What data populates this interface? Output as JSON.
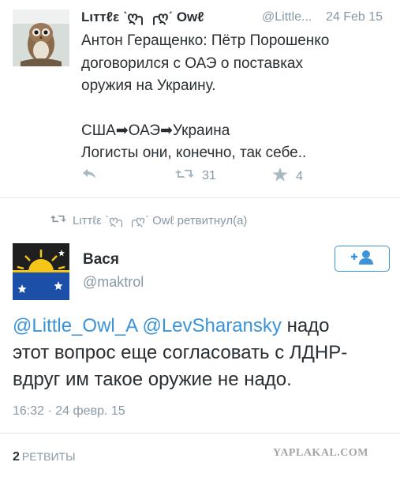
{
  "tweet": {
    "author_name": "Lιттℓε ˋღ╮ ╭ღˊ Owℓ",
    "author_handle": "@Little...",
    "date": "24 Feb 15",
    "text_lines": [
      "Антон Геращенко: Пётр Порошенко",
      "договорился с ОАЭ о поставках",
      "оружия на Украину.",
      "",
      "США➡ОАЭ➡Украина",
      "Логисты они, конечно, так себе.."
    ],
    "actions": {
      "reply_icon": "reply-icon",
      "retweet_icon": "retweet-icon",
      "retweet_count": "31",
      "favorite_icon": "star-icon",
      "favorite_count": "4"
    }
  },
  "retweet_notice": {
    "icon": "retweet-icon",
    "text": "Lιттℓε ˋღ╮ ╭ღˊ Owℓ ретвитнул(а)"
  },
  "reply_tweet": {
    "author_name": "Вася",
    "author_handle": "@maktrol",
    "follow_icon": "follow-user-icon",
    "mentions": [
      "@Little_Owl_A",
      "@LevSharansky"
    ],
    "text_line1_rest": " надо",
    "text_line2": "этот вопрос еще согласовать с ЛДНР-",
    "text_line3": "вдруг им такое оружие не надо.",
    "timestamp": "16:32 · 24 февр. 15"
  },
  "footer": {
    "retweet_count": "2",
    "retweet_label": "РЕТВИТЫ"
  },
  "watermark": "YAPLAKAL.COM",
  "colors": {
    "link": "#3b94d9",
    "muted": "#8899a6",
    "text": "#292f33",
    "divider": "#e1e8ed"
  }
}
